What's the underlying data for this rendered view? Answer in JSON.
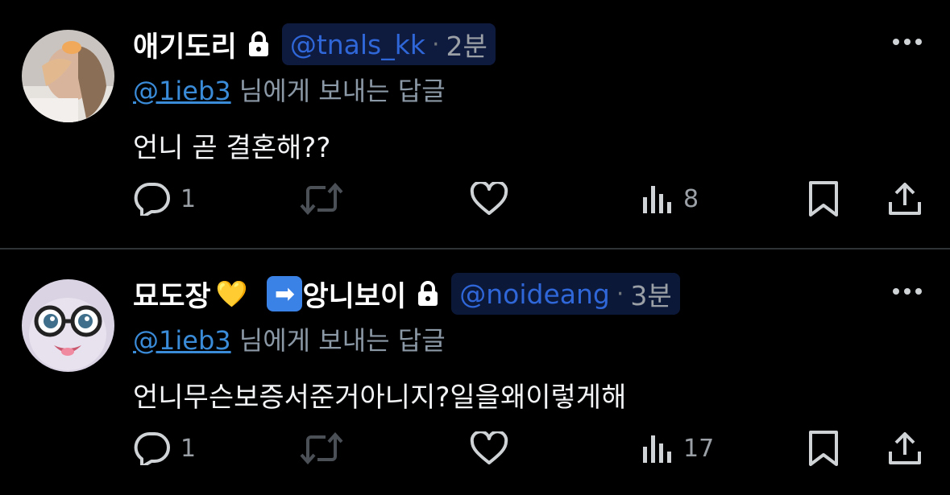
{
  "tweets": [
    {
      "name": "애기도리",
      "handle": "@tnals_kk",
      "separator": "·",
      "time": "2분",
      "reply_mention": "@1ieb3",
      "reply_suffix": " 님에게 보내는 답글",
      "text": "언니 곧 결혼해??",
      "replies": "1",
      "views": "8",
      "avatar_icon": "person-photo-avatar",
      "accent_color": "#2f66d8"
    },
    {
      "name": "묘도장",
      "name_emoji_heart": "💛",
      "name_arrow": "➡",
      "name_suffix": "앙니보이",
      "handle": "@noideang",
      "separator": "·",
      "time": "3분",
      "reply_mention": "@1ieb3",
      "reply_suffix": " 님에게 보내는 답글",
      "text": "언니무슨보증서준거아니지?일을왜이렇게해",
      "replies": "1",
      "views": "17",
      "avatar_icon": "cartoon-glasses-avatar",
      "accent_color": "#2f66d8"
    }
  ],
  "icons": {
    "lock": "lock-icon",
    "more": "more-icon",
    "reply": "reply-icon",
    "retweet": "retweet-icon",
    "like": "heart-icon",
    "views": "views-icon",
    "bookmark": "bookmark-icon",
    "share": "share-icon"
  }
}
